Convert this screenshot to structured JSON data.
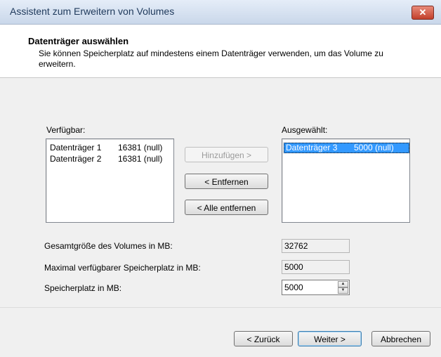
{
  "window": {
    "title": "Assistent zum Erweitern von Volumes",
    "close_glyph": "✕"
  },
  "header": {
    "title": "Datenträger auswählen",
    "subtitle": "Sie können Speicherplatz auf mindestens einem Datenträger verwenden, um das Volume zu erweitern."
  },
  "available": {
    "label": "Verfügbar:",
    "items": [
      {
        "name": "Datenträger 1",
        "size": "16381 (null)"
      },
      {
        "name": "Datenträger 2",
        "size": "16381 (null)"
      }
    ]
  },
  "selected": {
    "label": "Ausgewählt:",
    "items": [
      {
        "name": "Datenträger 3",
        "size": "5000 (null)"
      }
    ]
  },
  "buttons": {
    "add": "Hinzufügen >",
    "remove": "< Entfernen",
    "remove_all": "< Alle entfernen"
  },
  "fields": {
    "total_label": "Gesamtgröße des Volumes in MB:",
    "total_value": "32762",
    "max_label": "Maximal verfügbarer Speicherplatz in MB:",
    "max_value": "5000",
    "space_label": "Speicherplatz in MB:",
    "space_value": "5000"
  },
  "footer": {
    "back": "< Zurück",
    "next": "Weiter >",
    "cancel": "Abbrechen"
  }
}
